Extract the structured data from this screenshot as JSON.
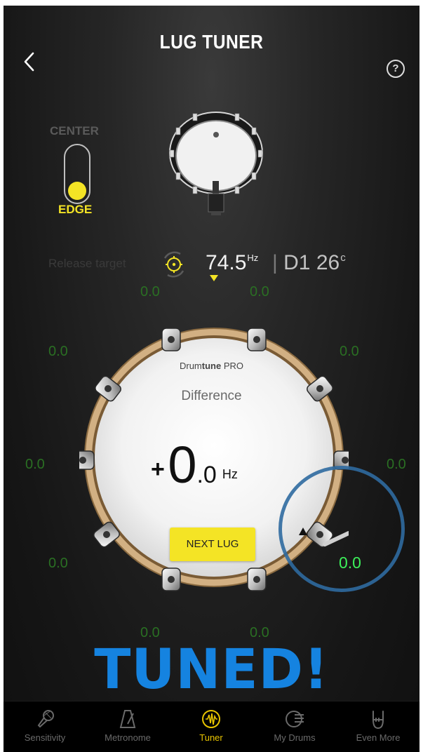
{
  "header": {
    "title": "LUG TUNER"
  },
  "position_toggle": {
    "top_label": "CENTER",
    "bottom_label": "EDGE"
  },
  "readout": {
    "release_label": "Release target",
    "frequency": "74.5",
    "frequency_unit": "Hz",
    "separator": "|",
    "note": "D1 26",
    "cent_unit": "c"
  },
  "lug_values": {
    "top_left": "0.0",
    "top_right": "0.0",
    "upper_left": "0.0",
    "upper_right": "0.0",
    "middle_left": "0.0",
    "middle_right": "0.0",
    "lower_left": "0.0",
    "lower_right": "0.0",
    "bottom_left": "0.0",
    "bottom_right": "0.0"
  },
  "drum": {
    "brand_light": "Drum",
    "brand_bold": "tune",
    "brand_suffix": " PRO",
    "difference_label": "Difference",
    "sign": "+",
    "integer": "0",
    "decimal": ".0",
    "unit": "Hz",
    "next_button": "NEXT LUG"
  },
  "status": {
    "tuned": "TUNED!"
  },
  "tabs": [
    {
      "label": "Sensitivity",
      "icon": "microphone-icon"
    },
    {
      "label": "Metronome",
      "icon": "metronome-icon"
    },
    {
      "label": "Tuner",
      "icon": "tuner-icon"
    },
    {
      "label": "My Drums",
      "icon": "my-drums-icon"
    },
    {
      "label": "Even More",
      "icon": "rock-hand-icon"
    }
  ],
  "colors": {
    "accent_yellow": "#f4e425",
    "tuned_blue": "#1583e0",
    "active_lug_green": "#3df05a",
    "lug_value_green": "#2a6f23",
    "focus_ring_blue": "#2f6aa0"
  }
}
